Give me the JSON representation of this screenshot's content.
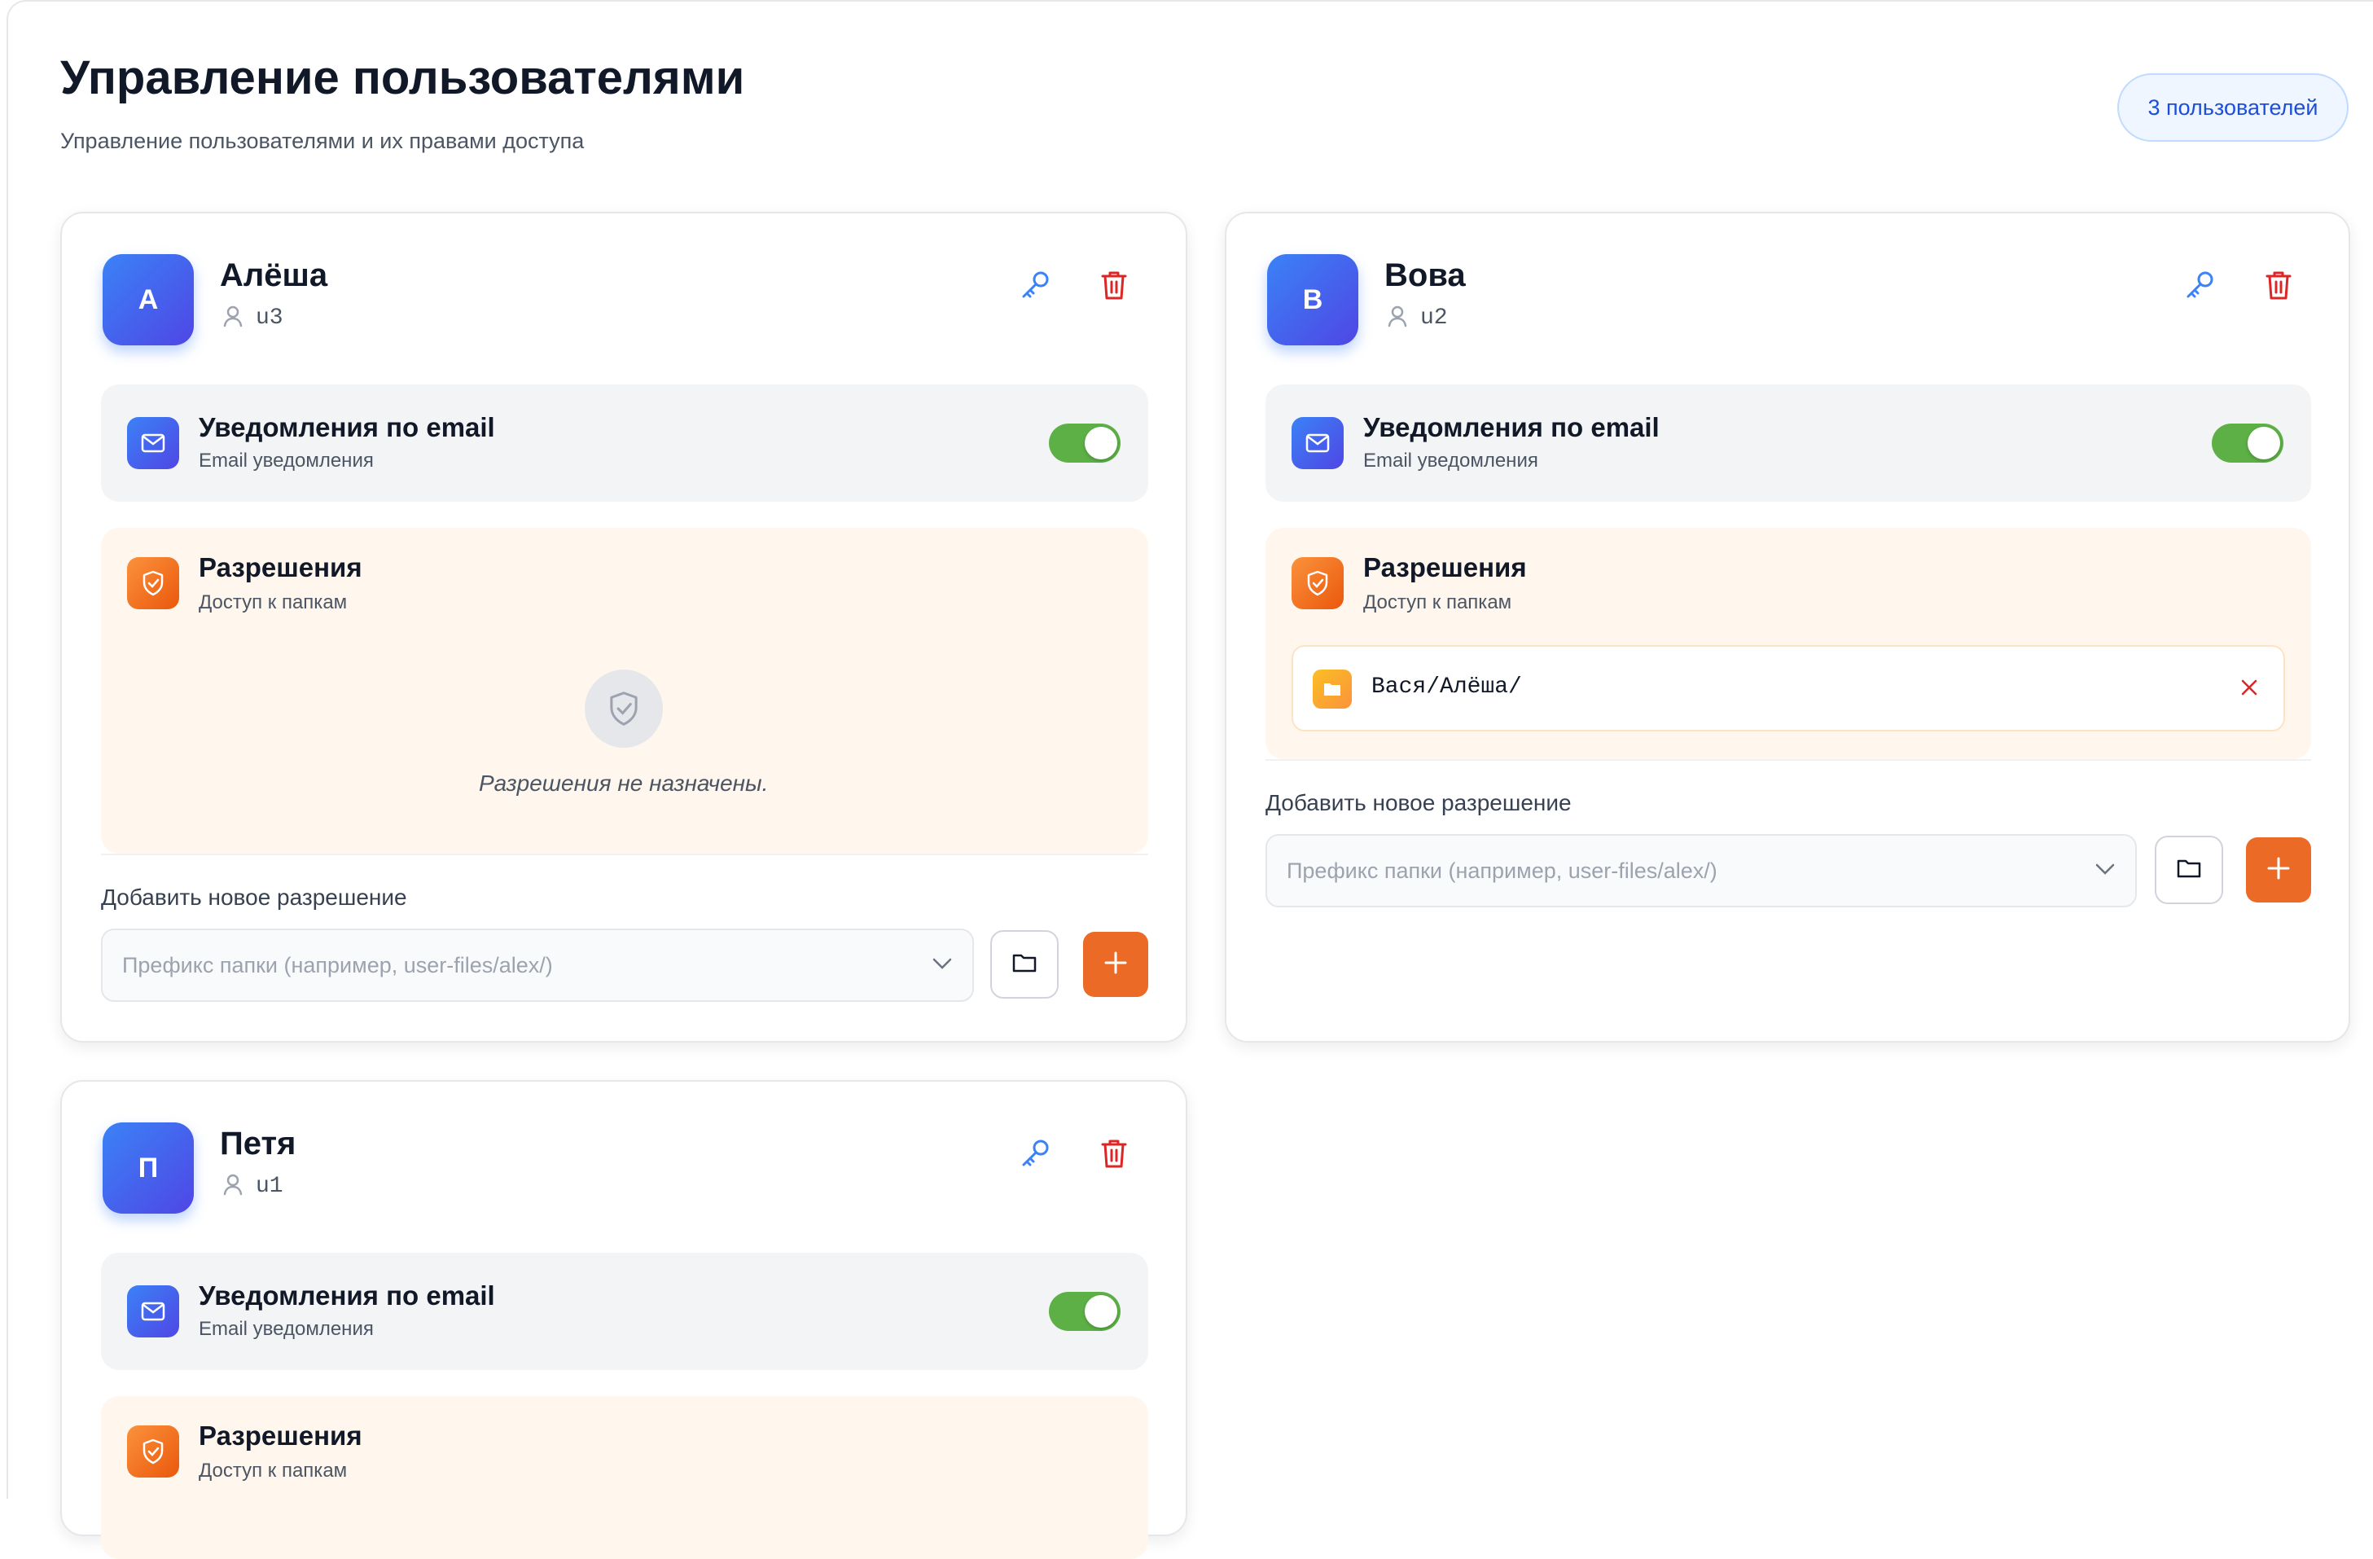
{
  "header": {
    "title": "Управление пользователями",
    "subtitle": "Управление пользователями и их правами доступа",
    "user_count": "3 пользователей"
  },
  "users": [
    {
      "initial": "А",
      "name": "Алёша",
      "login": "u3",
      "email_title": "Уведомления по email",
      "email_subtitle": "Email уведомления",
      "email_enabled": true,
      "permissions_title": "Разрешения",
      "permissions_subtitle": "Доступ к папкам",
      "permissions": [],
      "empty_text": "Разрешения не назначены.",
      "add_label": "Добавить новое разрешение",
      "prefix_placeholder": "Префикс папки (например, user-files/alex/)"
    },
    {
      "initial": "В",
      "name": "Вова",
      "login": "u2",
      "email_title": "Уведомления по email",
      "email_subtitle": "Email уведомления",
      "email_enabled": true,
      "permissions_title": "Разрешения",
      "permissions_subtitle": "Доступ к папкам",
      "permissions": [
        "Вася/Алёша/"
      ],
      "add_label": "Добавить новое разрешение",
      "prefix_placeholder": "Префикс папки (например, user-files/alex/)"
    },
    {
      "initial": "П",
      "name": "Петя",
      "login": "u1",
      "email_title": "Уведомления по email",
      "email_subtitle": "Email уведомления",
      "email_enabled": true,
      "permissions_title": "Разрешения",
      "permissions_subtitle": "Доступ к папкам"
    }
  ],
  "icons": {
    "key": "key-icon",
    "trash": "trash-icon",
    "user": "user-icon",
    "mail": "mail-icon",
    "shield": "shield-check-icon",
    "folder": "folder-icon",
    "chevron": "chevron-down-icon",
    "plus": "plus-icon",
    "close": "close-icon"
  },
  "colors": {
    "accent_blue": "#3b82f6",
    "accent_indigo": "#4f46e5",
    "accent_orange": "#ea6a26",
    "toggle_on": "#5cb046",
    "danger": "#dc2626"
  }
}
